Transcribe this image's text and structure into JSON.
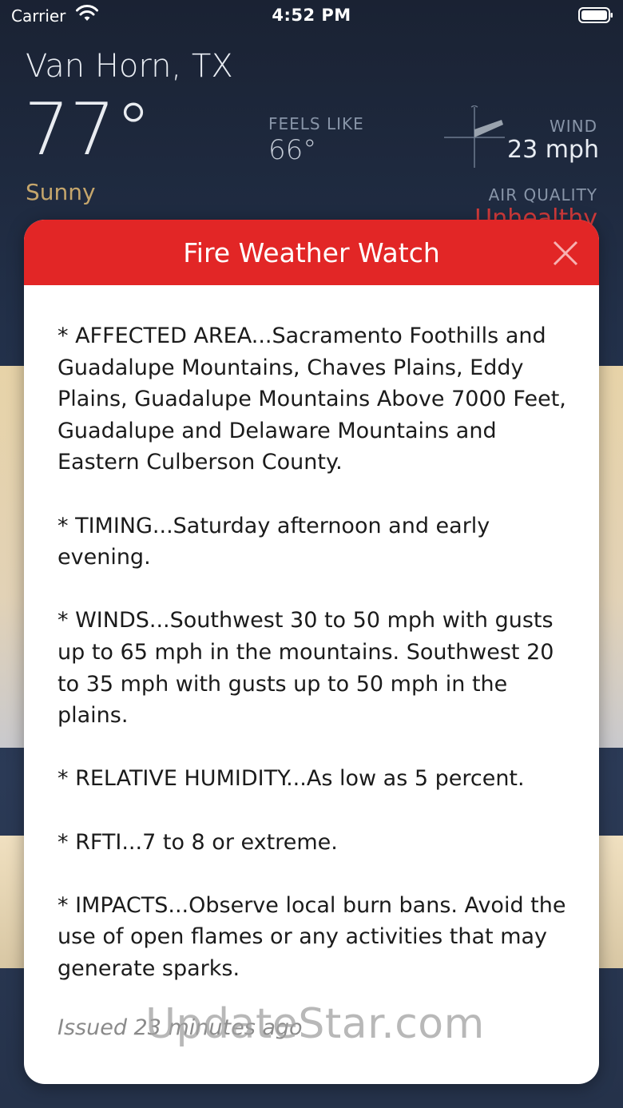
{
  "status_bar": {
    "carrier": "Carrier",
    "time": "4:52 PM"
  },
  "location": {
    "city": "Van Horn, TX"
  },
  "current": {
    "temperature": "77°",
    "condition": "Sunny",
    "feels_like_label": "FEELS LIKE",
    "feels_like_value": "66°",
    "wind_label": "WIND",
    "wind_value": "23 mph",
    "air_quality_label": "AIR QUALITY",
    "air_quality_value": "Unhealthy"
  },
  "alert": {
    "title": "Fire Weather Watch",
    "paragraphs": [
      "* AFFECTED AREA...Sacramento Foothills and Guadalupe Mountains, Chaves Plains, Eddy Plains, Guadalupe Mountains Above 7000 Feet, Guadalupe and Delaware Mountains and Eastern Culberson County.",
      "* TIMING...Saturday afternoon and early evening.",
      "* WINDS...Southwest 30 to 50 mph with gusts up to 65 mph in the mountains. Southwest 20 to 35 mph with gusts up to 50 mph in the plains.",
      "* RELATIVE HUMIDITY...As low as 5 percent.",
      "* RFTI...7 to 8 or extreme.",
      "* IMPACTS...Observe local burn bans. Avoid the use of open flames or any activities that may generate sparks."
    ],
    "issued": "Issued 23 minutes ago",
    "header_color": "#e22626"
  },
  "watermark": "UpdateStar.com",
  "colors": {
    "background": "#1f2a3c",
    "condition": "#c5a66c",
    "air_quality_alert": "#d03a3a"
  },
  "icons": {
    "wifi": "wifi-icon",
    "battery": "battery-icon",
    "wind": "wind-compass-icon",
    "close": "close-icon"
  }
}
